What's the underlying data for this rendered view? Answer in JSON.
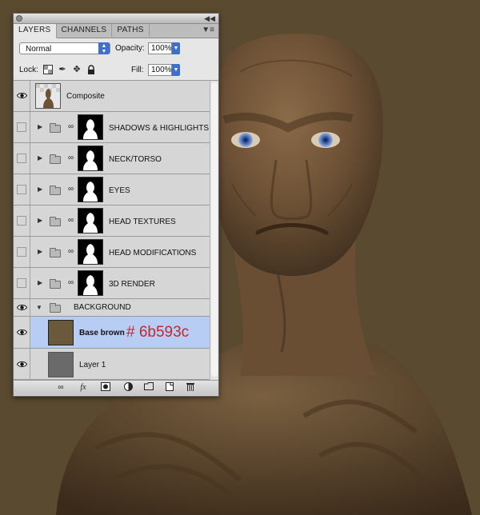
{
  "colors": {
    "canvas_background": "#5a4a30",
    "base_brown_swatch": "#6b593c",
    "layer1_swatch": "#6a6a6a",
    "selected_row": "#b8cdf4",
    "annotation_text": "#c0282e"
  },
  "panel": {
    "tabs": [
      {
        "label": "LAYERS",
        "active": true
      },
      {
        "label": "CHANNELS",
        "active": false
      },
      {
        "label": "PATHS",
        "active": false
      }
    ],
    "menu_icon": "panel-menu-icon",
    "blend_mode": "Normal",
    "opacity_label": "Opacity:",
    "opacity_value": "100%",
    "lock_label": "Lock:",
    "fill_label": "Fill:",
    "fill_value": "100%"
  },
  "layers": [
    {
      "name": "Composite",
      "visible": true,
      "type": "pixel"
    },
    {
      "name": "SHADOWS & HIGHLIGHTS",
      "visible": false,
      "type": "group-mask"
    },
    {
      "name": "NECK/TORSO",
      "visible": false,
      "type": "group-mask"
    },
    {
      "name": "EYES",
      "visible": false,
      "type": "group-mask"
    },
    {
      "name": "HEAD TEXTURES",
      "visible": false,
      "type": "group-mask"
    },
    {
      "name": "HEAD MODIFICATIONS",
      "visible": false,
      "type": "group-mask"
    },
    {
      "name": "3D RENDER",
      "visible": false,
      "type": "group-mask"
    },
    {
      "name": "BACKGROUND",
      "visible": true,
      "type": "group-open"
    },
    {
      "name": "Base brown",
      "visible": true,
      "type": "fill",
      "selected": true
    },
    {
      "name": "Layer 1",
      "visible": true,
      "type": "fill"
    }
  ],
  "annotation": "# 6b593c",
  "bottom_icons": [
    "link-layers-icon",
    "fx-icon",
    "add-mask-icon",
    "adjustment-layer-icon",
    "new-group-icon",
    "new-layer-icon",
    "trash-icon"
  ]
}
